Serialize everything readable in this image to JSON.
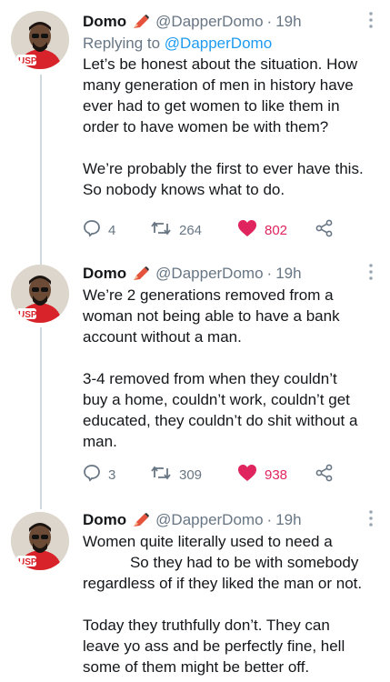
{
  "colors": {
    "like": "#e0245e",
    "link": "#1d9bf0",
    "muted": "#687684",
    "line": "#cfd9de"
  },
  "tweets": [
    {
      "name": "Domo",
      "handle": "@DapperDomo",
      "dot": "·",
      "time": "19h",
      "reply_prefix": "Replying to ",
      "reply_to": "@DapperDomo",
      "lines": [
        "Let’s be honest about the situation. How",
        "many generation of men in history have",
        "ever had to get women to like them in",
        "order to have women be with them?",
        "",
        "We’re probably the first to ever have this.",
        "So nobody knows what to do."
      ],
      "replies": "4",
      "retweets": "264",
      "likes": "802"
    },
    {
      "name": "Domo",
      "handle": "@DapperDomo",
      "dot": "·",
      "time": "19h",
      "lines": [
        "We’re 2 generations removed from a",
        "woman not being able to have a bank",
        "account without a man.",
        "",
        "3-4 removed from when they couldn’t",
        "buy a home, couldn’t work, couldn’t get",
        "educated, they couldn’t do shit without a",
        "man."
      ],
      "replies": "3",
      "retweets": "309",
      "likes": "938"
    },
    {
      "name": "Domo",
      "handle": "@DapperDomo",
      "dot": "·",
      "time": "19h",
      "lines": [
        "Women quite literally used to need a",
        "           So they had to be with somebody",
        "regardless of if they liked the man or not.",
        "",
        "Today they truthfully don’t. They can",
        "leave yo ass and be perfectly fine, hell",
        "some of them might be better off."
      ]
    }
  ],
  "avatar_badge": "USP",
  "icons": [
    "reply-icon",
    "retweet-icon",
    "heart-icon",
    "share-icon",
    "more-icon",
    "pen-icon"
  ]
}
